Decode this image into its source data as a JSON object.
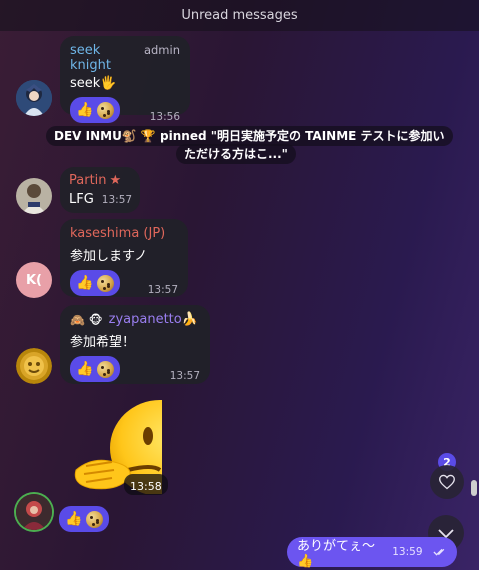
{
  "banner": {
    "text": "Unread messages"
  },
  "messages": [
    {
      "sender": "seek knight",
      "sender_color": "#6fb6e8",
      "role": "admin",
      "text": "seek🖐",
      "time": "13:56",
      "reactions": [
        "thumbs-up",
        "cookie"
      ]
    },
    {
      "pin": {
        "line1": "DEV INMU🐒 🏆 pinned \"明日実施予定の TAINME テストに参加い",
        "line2": "ただける方はこ...\""
      }
    },
    {
      "sender": "Partin",
      "sender_color": "#e0675b",
      "sender_icon": "star",
      "text": "LFG",
      "time": "13:57"
    },
    {
      "sender": "kaseshima (JP)",
      "sender_color": "#e0675b",
      "avatar_initials": "K(",
      "avatar_color": "#e8a0a8",
      "text": "参加しますノ",
      "time": "13:57",
      "reactions": [
        "thumbs-up",
        "cookie"
      ]
    },
    {
      "sender_prefix": "🙈 🐵",
      "sender": "zyapanetto🍌",
      "sender_color": "#9a7ef0",
      "text": "参加希望！",
      "time": "13:57",
      "reactions": [
        "thumbs-up",
        "cookie"
      ]
    },
    {
      "sticker": "🫠",
      "time": "13:58",
      "reactions": [
        "thumbs-up",
        "cookie"
      ]
    }
  ],
  "outgoing": {
    "text": "ありがてぇ〜👍",
    "time": "13:59"
  },
  "controls": {
    "unread_reactions_count": "2"
  },
  "colors": {
    "accent": "#5a4be8",
    "outgoing_bubble": "#6c55f0"
  }
}
